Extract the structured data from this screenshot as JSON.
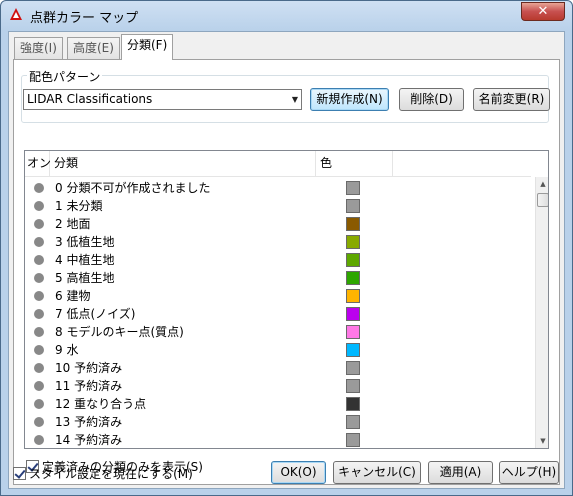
{
  "window": {
    "title": "点群カラー マップ",
    "close_label": "✕"
  },
  "tabs": [
    {
      "label": "強度(I)"
    },
    {
      "label": "高度(E)"
    },
    {
      "label": "分類(F)"
    }
  ],
  "color_pattern": {
    "group_label": "配色パターン",
    "selected": "LIDAR Classifications",
    "new_button": "新規作成(N)",
    "delete_button": "削除(D)",
    "rename_button": "名前変更(R)"
  },
  "list": {
    "columns": [
      "オン",
      "分類",
      "色"
    ],
    "rows": [
      {
        "label": "0 分類不可が作成されました",
        "color": "#9a9a9a"
      },
      {
        "label": "1 未分類",
        "color": "#9a9a9a"
      },
      {
        "label": "2 地面",
        "color": "#8a5a00"
      },
      {
        "label": "3 低植生地",
        "color": "#88aa00"
      },
      {
        "label": "4 中植生地",
        "color": "#5ea800"
      },
      {
        "label": "5 高植生地",
        "color": "#2ea600"
      },
      {
        "label": "6 建物",
        "color": "#ffb400"
      },
      {
        "label": "7 低点(ノイズ)",
        "color": "#bb00ee"
      },
      {
        "label": "8 モデルのキー点(質点)",
        "color": "#ff78e6"
      },
      {
        "label": "9 水",
        "color": "#00b8ff"
      },
      {
        "label": "10 予約済み",
        "color": "#9a9a9a"
      },
      {
        "label": "11 予約済み",
        "color": "#9a9a9a"
      },
      {
        "label": "12 重なり合う点",
        "color": "#333333"
      },
      {
        "label": "13 予約済み",
        "color": "#9a9a9a"
      },
      {
        "label": "14 予約済み",
        "color": "#9a9a9a"
      }
    ]
  },
  "options": {
    "defined_only_label": "定義済みの分類のみを表示(S)",
    "defined_only_checked": true,
    "style_current_label": "スタイル設定を現在にする(M)",
    "style_current_checked": true
  },
  "buttons": {
    "ok": "OK(O)",
    "cancel": "キャンセル(C)",
    "apply": "適用(A)",
    "help": "ヘルプ(H)"
  }
}
